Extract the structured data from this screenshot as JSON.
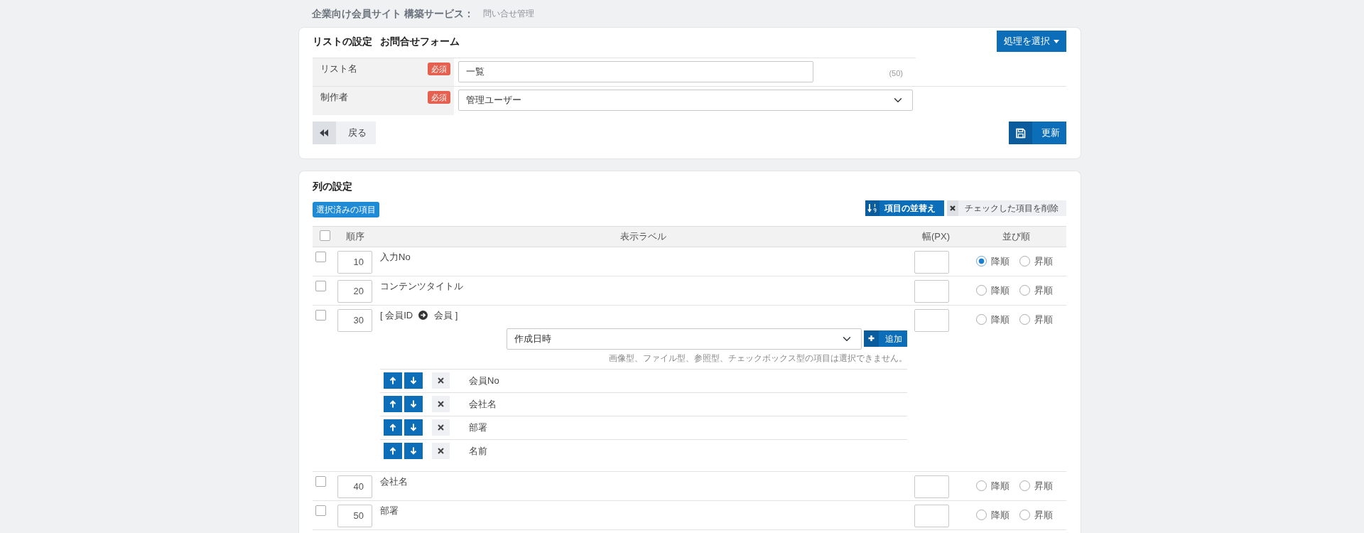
{
  "header": {
    "site_title": "企業向け会員サイト 構築サービス：",
    "page_title": "問い合せ管理"
  },
  "list_settings": {
    "title": "リストの設定",
    "form_name": "お問合せフォーム",
    "action_button": "処理を選択",
    "fields": [
      {
        "kind": "text",
        "label": "リスト名",
        "badge": "必須",
        "value": "一覧",
        "counter": "(50)"
      },
      {
        "kind": "select",
        "label": "制作者",
        "badge": "必須",
        "value": "管理ユーザー"
      }
    ],
    "back_button": "戻る",
    "update_button": "更新"
  },
  "column_settings": {
    "title": "列の設定",
    "selected_items_button": "選択済みの項目",
    "sort_button": "項目の並替え",
    "delete_button": "チェックした項目を削除",
    "header_checked": false,
    "columns": [
      "順序",
      "表示ラベル",
      "幅(PX)",
      "並び順"
    ],
    "rows": [
      {
        "kind": "field",
        "checked": false,
        "order": "10",
        "label": "入力No",
        "sort_options": [
          {
            "label": "降順",
            "selected": true
          },
          {
            "label": "昇順",
            "selected": false
          }
        ]
      },
      {
        "kind": "field",
        "checked": false,
        "order": "20",
        "label": "コンテンツタイトル",
        "sort_options": [
          {
            "label": "降順",
            "selected": false
          },
          {
            "label": "昇順",
            "selected": false
          }
        ]
      },
      {
        "kind": "relation",
        "checked": false,
        "order": "30",
        "label": "[ 会員ID",
        "target": "会員 ]",
        "field_select": "作成日時",
        "add_button": "追加",
        "note": "画像型、ファイル型、参照型、チェックボックス型の項目は選択できません。",
        "related_fields": [
          "会員No",
          "会社名",
          "部署",
          "名前"
        ],
        "sort_options": [
          {
            "label": "降順",
            "selected": false
          },
          {
            "label": "昇順",
            "selected": false
          }
        ]
      },
      {
        "kind": "field",
        "checked": false,
        "order": "40",
        "label": "会社名",
        "sort_options": [
          {
            "label": "降順",
            "selected": false
          },
          {
            "label": "昇順",
            "selected": false
          }
        ]
      },
      {
        "kind": "field",
        "checked": false,
        "order": "50",
        "label": "部署",
        "sort_options": [
          {
            "label": "降順",
            "selected": false
          },
          {
            "label": "昇順",
            "selected": false
          }
        ]
      }
    ]
  }
}
